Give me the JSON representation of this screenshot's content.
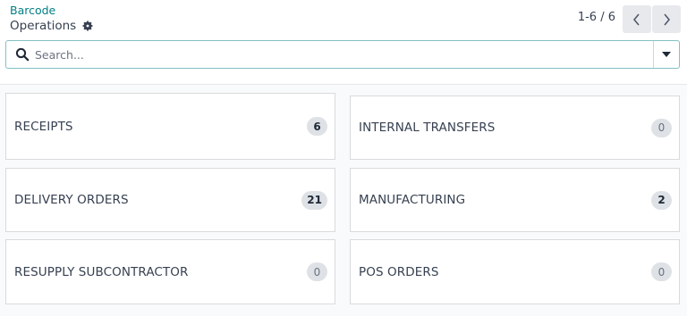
{
  "header": {
    "breadcrumb": "Barcode",
    "title": "Operations",
    "pager_text": "1-6 / 6"
  },
  "search": {
    "placeholder": "Search..."
  },
  "operations": [
    {
      "label": "RECEIPTS",
      "count": "6"
    },
    {
      "label": "INTERNAL TRANSFERS",
      "count": "0"
    },
    {
      "label": "DELIVERY ORDERS",
      "count": "21"
    },
    {
      "label": "MANUFACTURING",
      "count": "2"
    },
    {
      "label": "RESUPPLY SUBCONTRACTOR",
      "count": "0"
    },
    {
      "label": "POS ORDERS",
      "count": "0"
    }
  ],
  "icons": {
    "settings": "gear-icon",
    "search": "search-icon",
    "toggle": "caret-down-icon",
    "prev": "chevron-left-icon",
    "next": "chevron-right-icon"
  },
  "colors": {
    "link": "#017e84",
    "badge_bg": "#dee2e6",
    "focus_border": "#82c1c4"
  }
}
